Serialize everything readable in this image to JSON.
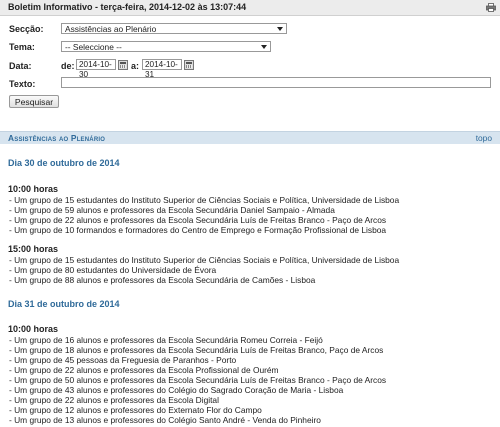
{
  "header": {
    "title": "Boletim Informativo - terça-feira, 2014-12-02 às 13:07:44",
    "print_icon": "printer-icon"
  },
  "form": {
    "seccao_label": "Secção:",
    "seccao_value": "Assistências ao Plenário",
    "tema_label": "Tema:",
    "tema_value": "-- Seleccione --",
    "data_label": "Data:",
    "de_label": "de:",
    "date_from": "2014-10-30",
    "a_label": "a:",
    "date_to": "2014-10-31",
    "texto_label": "Texto:",
    "texto_value": "",
    "search_button": "Pesquisar"
  },
  "section": {
    "title": "Assistências ao Plenário",
    "topo_link": "topo"
  },
  "days": [
    {
      "title": "Dia 30 de outubro de 2014",
      "groups": [
        {
          "hour": "10:00 horas",
          "items": [
            "- Um grupo de 15 estudantes do Instituto Superior de Ciências Sociais e Política, Universidade de Lisboa",
            "- Um grupo de 59 alunos e professores da Escola Secundária Daniel Sampaio - Almada",
            "- Um grupo de 22 alunos e professores da Escola Secundária Luís de Freitas Branco - Paço de Arcos",
            "- Um grupo de 10 formandos e formadores do Centro de Emprego e Formação Profissional de Lisboa"
          ]
        },
        {
          "hour": "15:00 horas",
          "items": [
            "- Um grupo de 15 estudantes do Instituto Superior de Ciências Sociais e Política, Universidade de Lisboa",
            "- Um grupo de 80 estudantes do Universidade de Évora",
            "- Um grupo de 88 alunos e professores da Escola Secundária de Camões - Lisboa"
          ]
        }
      ]
    },
    {
      "title": "Dia 31 de outubro de 2014",
      "groups": [
        {
          "hour": "10:00 horas",
          "items": [
            "- Um grupo de 16 alunos e professores da Escola Secundária Romeu Correia - Feijó",
            "- Um grupo de 18 alunos e professores da Escola Secundária Luís de Freitas Branco, Paço de Arcos",
            "- Um grupo de 45 pessoas da Freguesia de Paranhos - Porto",
            "- Um grupo de 22 alunos e professores da Escola Profissional de Ourém",
            "- Um grupo de 50 alunos e professores da Escola Secundária Luís de Freitas Branco - Paço de Arcos",
            "- Um grupo de 43 alunos e professores do Colégio do Sagrado Coração de Maria - Lisboa",
            "- Um grupo de 22 alunos e professores da Escola Digital",
            "- Um grupo de 12 alunos e professores do Externato Flor do Campo",
            "- Um grupo de 13 alunos e professores do Colégio Santo André - Venda do Pinheiro"
          ]
        }
      ]
    }
  ]
}
